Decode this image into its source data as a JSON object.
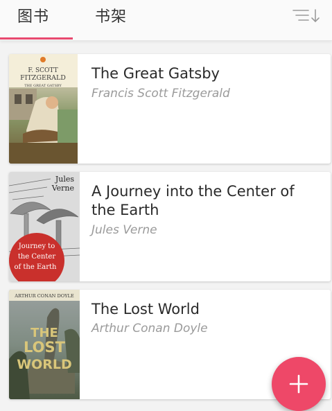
{
  "tabs": [
    {
      "label": "图书"
    },
    {
      "label": "书架"
    }
  ],
  "sort_icon": "sort-descending-icon",
  "books": [
    {
      "title": "The Great Gatsby",
      "author": "Francis Scott Fitzgerald",
      "cover_lines": [
        "F. SCOTT",
        "FITZGERALD",
        "THE GREAT GATSBY"
      ]
    },
    {
      "title": "A Journey into the Center of the Earth",
      "author": "Jules Verne",
      "cover_lines": [
        "Jules",
        "Verne",
        "Journey to",
        "the Center",
        "of the Earth"
      ]
    },
    {
      "title": "The Lost World",
      "author": "Arthur Conan Doyle",
      "cover_lines": [
        "ARTHUR CONAN DOYLE",
        "THE",
        "LOST",
        "WORLD"
      ]
    }
  ],
  "fab_icon": "plus-icon",
  "colors": {
    "accent": "#e8496f",
    "fab": "#ee4868"
  }
}
